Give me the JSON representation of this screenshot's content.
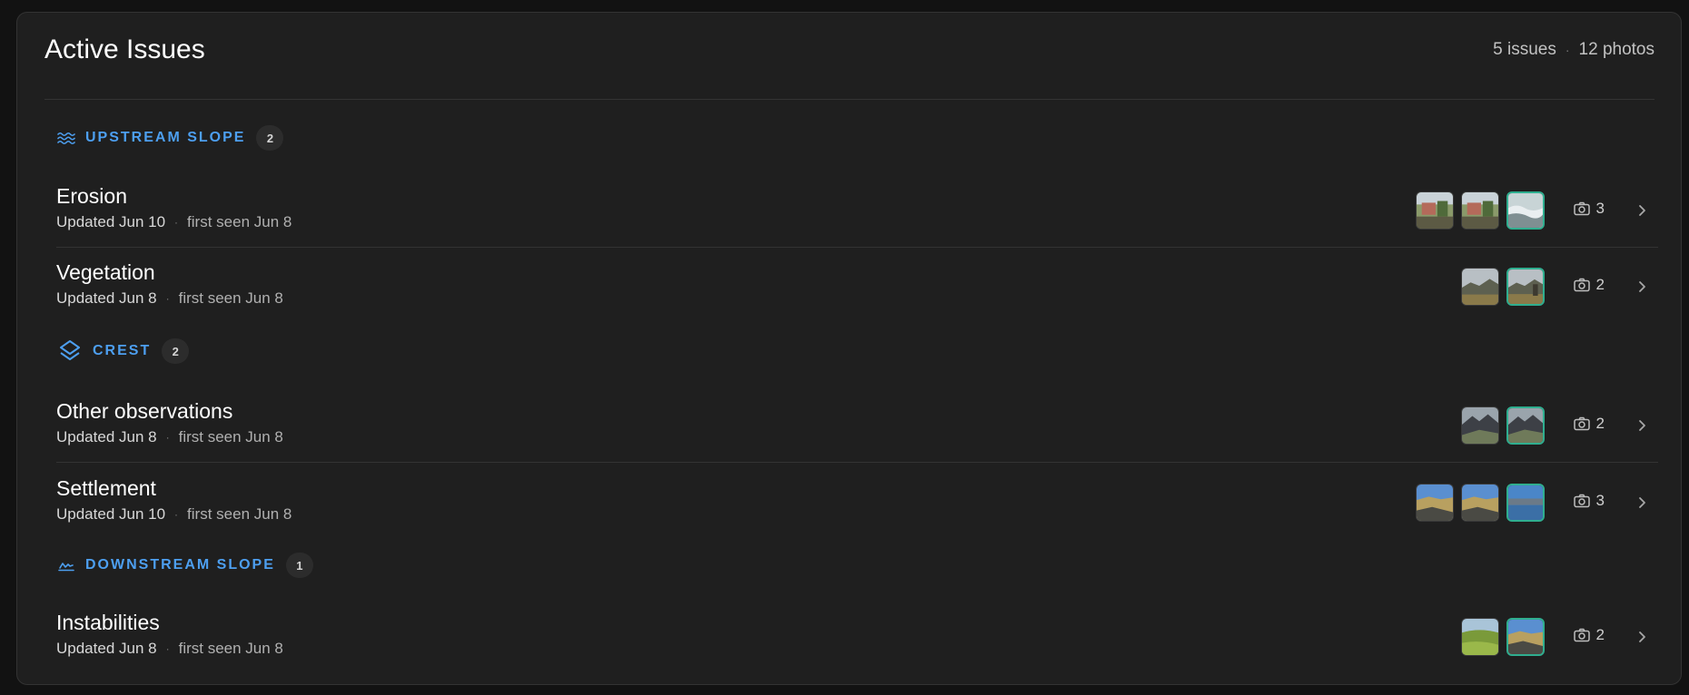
{
  "header": {
    "title": "Active Issues",
    "issues": "5 issues",
    "photos": "12 photos"
  },
  "sections": [
    {
      "label": "UPSTREAM SLOPE",
      "count": "2",
      "icon": "waves-icon",
      "issues": [
        {
          "title": "Erosion",
          "updated": "Updated Jun 10",
          "seen": "first seen Jun 8",
          "photo_count": "3"
        },
        {
          "title": "Vegetation",
          "updated": "Updated Jun 8",
          "seen": "first seen Jun 8",
          "photo_count": "2"
        }
      ]
    },
    {
      "label": "CREST",
      "count": "2",
      "icon": "layers-icon",
      "issues": [
        {
          "title": "Other observations",
          "updated": "Updated Jun 8",
          "seen": "first seen Jun 8",
          "photo_count": "2"
        },
        {
          "title": "Settlement",
          "updated": "Updated Jun 10",
          "seen": "first seen Jun 8",
          "photo_count": "3"
        }
      ]
    },
    {
      "label": "DOWNSTREAM SLOPE",
      "count": "1",
      "icon": "slope-chart-icon",
      "issues": [
        {
          "title": "Instabilities",
          "updated": "Updated Jun 8",
          "seen": "first seen Jun 8",
          "photo_count": "2"
        }
      ]
    }
  ],
  "colors": {
    "accent": "#4d9ff0",
    "active_thumb": "#2fae8f",
    "card": "#1f1f1f",
    "background": "#121212"
  }
}
